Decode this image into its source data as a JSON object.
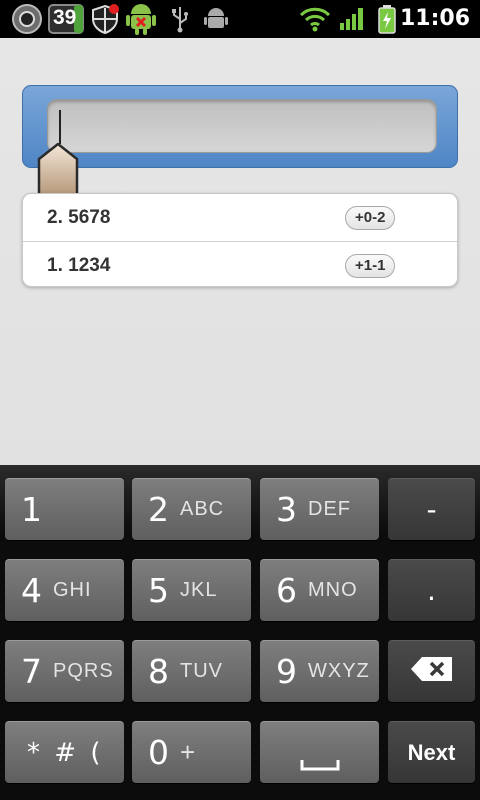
{
  "status_bar": {
    "time": "11:06",
    "notification_badge": "39",
    "icons": [
      "app-icon",
      "calendar-badge-icon",
      "shield-icon",
      "android-alert-icon",
      "usb-icon",
      "android-debug-icon",
      "wifi-icon",
      "signal-icon",
      "battery-charging-icon"
    ]
  },
  "input": {
    "value": "",
    "placeholder": ""
  },
  "history": [
    {
      "label": "2. 5678",
      "badge": "+0-2"
    },
    {
      "label": "1. 1234",
      "badge": "+1-1"
    }
  ],
  "keyboard": {
    "rows": [
      [
        {
          "num": "1",
          "letters": ""
        },
        {
          "num": "2",
          "letters": "ABC"
        },
        {
          "num": "3",
          "letters": "DEF"
        },
        {
          "sym": "-"
        }
      ],
      [
        {
          "num": "4",
          "letters": "GHI"
        },
        {
          "num": "5",
          "letters": "JKL"
        },
        {
          "num": "6",
          "letters": "MNO"
        },
        {
          "sym": "."
        }
      ],
      [
        {
          "num": "7",
          "letters": "PQRS"
        },
        {
          "num": "8",
          "letters": "TUV"
        },
        {
          "num": "9",
          "letters": "WXYZ"
        },
        {
          "icon": "backspace-icon"
        }
      ],
      [
        {
          "special": "* # ("
        },
        {
          "num": "0",
          "letters": "+"
        },
        {
          "icon": "space-icon"
        },
        {
          "label": "Next"
        }
      ]
    ]
  },
  "colors": {
    "accent_blue": "#5a8fcf",
    "key_face": "#6f6f6f",
    "key_dark": "#3f3f3f",
    "status_green": "#7ac943"
  }
}
